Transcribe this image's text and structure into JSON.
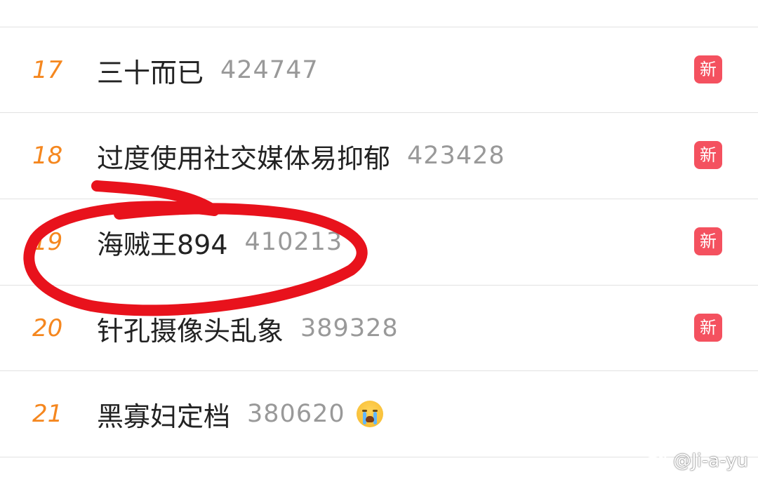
{
  "trending_list": {
    "items": [
      {
        "rank": "17",
        "title": "三十而已",
        "count": "424747",
        "badge": "新"
      },
      {
        "rank": "18",
        "title": "过度使用社交媒体易抑郁",
        "count": "423428",
        "badge": "新"
      },
      {
        "rank": "19",
        "title": "海贼王894",
        "count": "410213",
        "badge": "新"
      },
      {
        "rank": "20",
        "title": "针孔摄像头乱象",
        "count": "389328",
        "badge": "新"
      },
      {
        "rank": "21",
        "title": "黑寡妇定档",
        "count": "380620",
        "emoji": "crying-face-icon"
      }
    ]
  },
  "watermark": {
    "text": "@Ji-a-yu",
    "icon": "weibo-icon"
  },
  "colors": {
    "rank": "#f5871f",
    "badge": "#f4515f",
    "annotation": "#e8121c"
  }
}
